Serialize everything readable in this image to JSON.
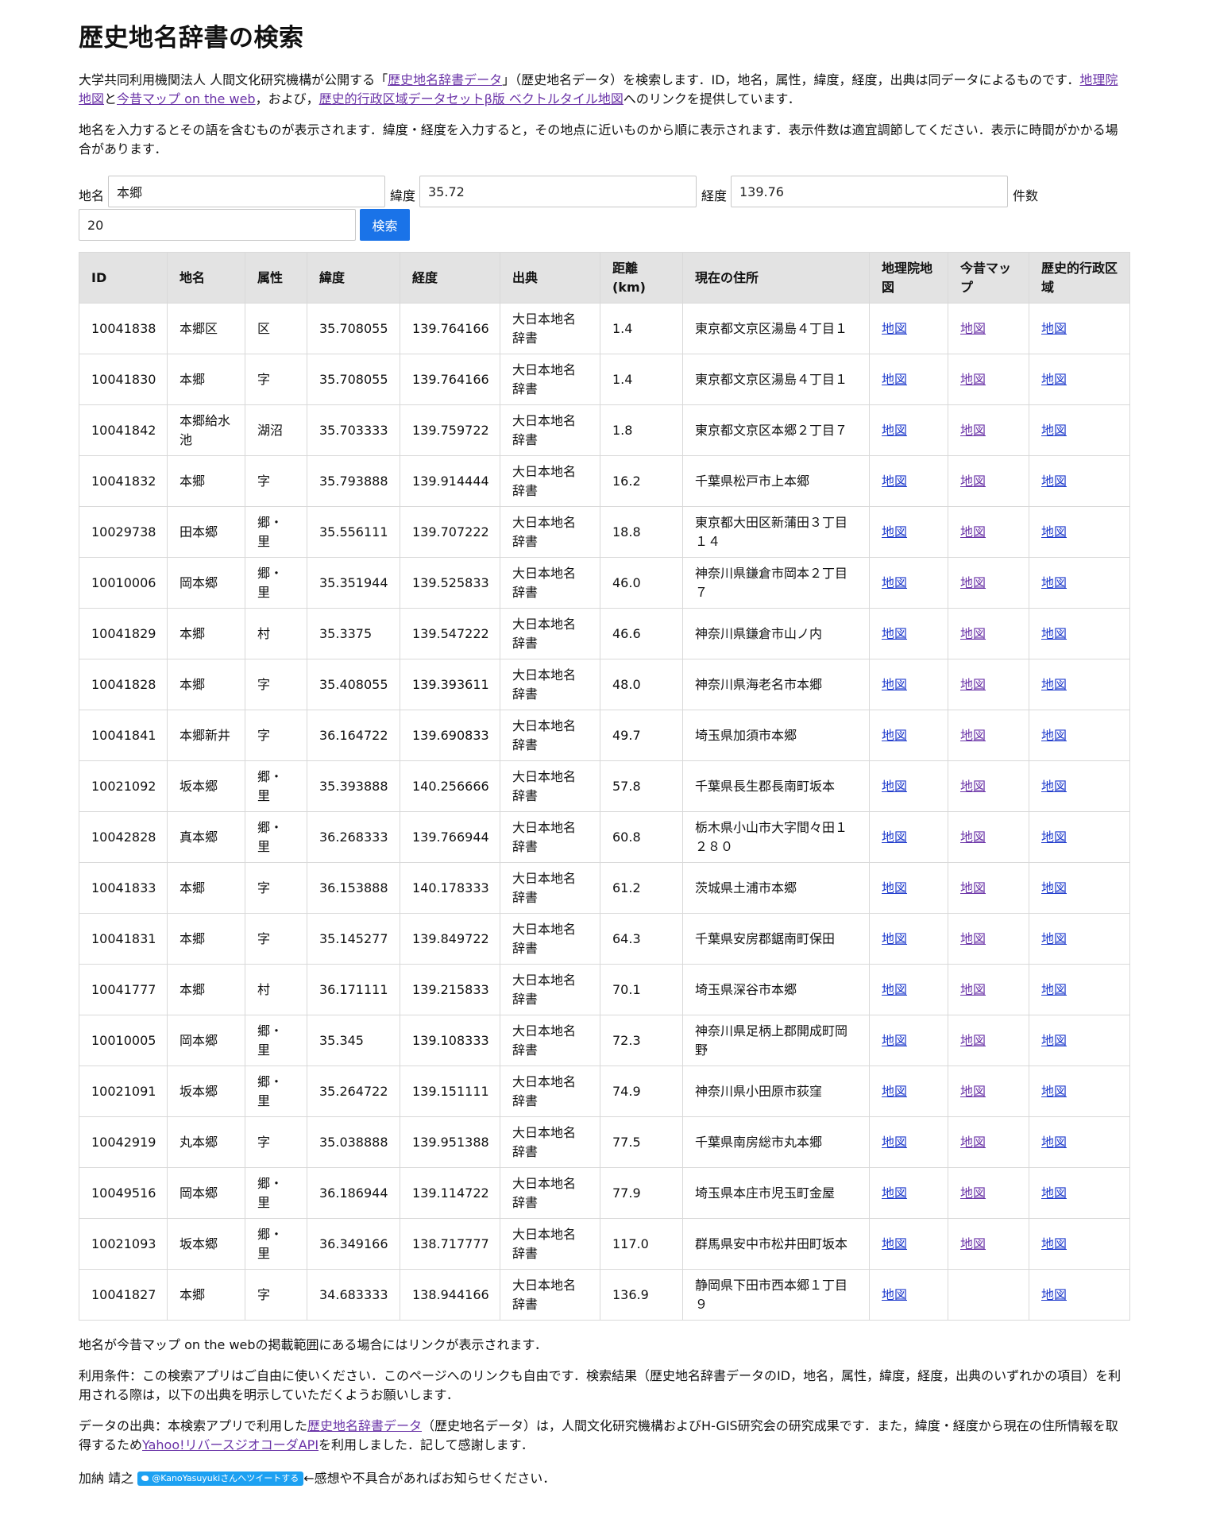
{
  "title": "歴史地名辞書の検索",
  "intro": {
    "part1": "大学共同利用機関法人 人間文化研究機構が公開する「",
    "link1": "歴史地名辞書データ",
    "part2": "」（歴史地名データ）を検索します．ID，地名，属性，緯度，経度，出典は同データによるものです．",
    "link2": "地理院地図",
    "part3": "と",
    "link3": "今昔マップ on the web",
    "part4": "，および，",
    "link4": "歴史的行政区域データセットβ版 ベクトルタイル地図",
    "part5": "へのリンクを提供しています．"
  },
  "instructions": "地名を入力するとその語を含むものが表示されます．緯度・経度を入力すると，その地点に近いものから順に表示されます．表示件数は適宜調節してください．表示に時間がかかる場合があります．",
  "form": {
    "name_label": "地名",
    "name_value": "本郷",
    "lat_label": "緯度",
    "lat_value": "35.72",
    "lon_label": "経度",
    "lon_value": "139.76",
    "count_label": "件数",
    "count_value": "20",
    "search_label": "検索"
  },
  "table": {
    "headers": [
      "ID",
      "地名",
      "属性",
      "緯度",
      "経度",
      "出典",
      "距離(km)",
      "現在の住所",
      "地理院地図",
      "今昔マップ",
      "歴史的行政区域"
    ],
    "link_label": "地図",
    "rows": [
      {
        "id": "10041838",
        "name": "本郷区",
        "attr": "区",
        "lat": "35.708055",
        "lon": "139.764166",
        "src": "大日本地名辞書",
        "dist": "1.4",
        "addr": "東京都文京区湯島４丁目１",
        "konjaku": true
      },
      {
        "id": "10041830",
        "name": "本郷",
        "attr": "字",
        "lat": "35.708055",
        "lon": "139.764166",
        "src": "大日本地名辞書",
        "dist": "1.4",
        "addr": "東京都文京区湯島４丁目１",
        "konjaku": true
      },
      {
        "id": "10041842",
        "name": "本郷給水池",
        "attr": "湖沼",
        "lat": "35.703333",
        "lon": "139.759722",
        "src": "大日本地名辞書",
        "dist": "1.8",
        "addr": "東京都文京区本郷２丁目７",
        "konjaku": true
      },
      {
        "id": "10041832",
        "name": "本郷",
        "attr": "字",
        "lat": "35.793888",
        "lon": "139.914444",
        "src": "大日本地名辞書",
        "dist": "16.2",
        "addr": "千葉県松戸市上本郷",
        "konjaku": true
      },
      {
        "id": "10029738",
        "name": "田本郷",
        "attr": "郷・里",
        "lat": "35.556111",
        "lon": "139.707222",
        "src": "大日本地名辞書",
        "dist": "18.8",
        "addr": "東京都大田区新蒲田３丁目１４",
        "konjaku": true
      },
      {
        "id": "10010006",
        "name": "岡本郷",
        "attr": "郷・里",
        "lat": "35.351944",
        "lon": "139.525833",
        "src": "大日本地名辞書",
        "dist": "46.0",
        "addr": "神奈川県鎌倉市岡本２丁目７",
        "konjaku": true
      },
      {
        "id": "10041829",
        "name": "本郷",
        "attr": "村",
        "lat": "35.3375",
        "lon": "139.547222",
        "src": "大日本地名辞書",
        "dist": "46.6",
        "addr": "神奈川県鎌倉市山ノ内",
        "konjaku": true
      },
      {
        "id": "10041828",
        "name": "本郷",
        "attr": "字",
        "lat": "35.408055",
        "lon": "139.393611",
        "src": "大日本地名辞書",
        "dist": "48.0",
        "addr": "神奈川県海老名市本郷",
        "konjaku": true
      },
      {
        "id": "10041841",
        "name": "本郷新井",
        "attr": "字",
        "lat": "36.164722",
        "lon": "139.690833",
        "src": "大日本地名辞書",
        "dist": "49.7",
        "addr": "埼玉県加須市本郷",
        "konjaku": true
      },
      {
        "id": "10021092",
        "name": "坂本郷",
        "attr": "郷・里",
        "lat": "35.393888",
        "lon": "140.256666",
        "src": "大日本地名辞書",
        "dist": "57.8",
        "addr": "千葉県長生郡長南町坂本",
        "konjaku": true
      },
      {
        "id": "10042828",
        "name": "真本郷",
        "attr": "郷・里",
        "lat": "36.268333",
        "lon": "139.766944",
        "src": "大日本地名辞書",
        "dist": "60.8",
        "addr": "栃木県小山市大字間々田１２８０",
        "konjaku": true
      },
      {
        "id": "10041833",
        "name": "本郷",
        "attr": "字",
        "lat": "36.153888",
        "lon": "140.178333",
        "src": "大日本地名辞書",
        "dist": "61.2",
        "addr": "茨城県土浦市本郷",
        "konjaku": true
      },
      {
        "id": "10041831",
        "name": "本郷",
        "attr": "字",
        "lat": "35.145277",
        "lon": "139.849722",
        "src": "大日本地名辞書",
        "dist": "64.3",
        "addr": "千葉県安房郡鋸南町保田",
        "konjaku": true
      },
      {
        "id": "10041777",
        "name": "本郷",
        "attr": "村",
        "lat": "36.171111",
        "lon": "139.215833",
        "src": "大日本地名辞書",
        "dist": "70.1",
        "addr": "埼玉県深谷市本郷",
        "konjaku": true
      },
      {
        "id": "10010005",
        "name": "岡本郷",
        "attr": "郷・里",
        "lat": "35.345",
        "lon": "139.108333",
        "src": "大日本地名辞書",
        "dist": "72.3",
        "addr": "神奈川県足柄上郡開成町岡野",
        "konjaku": true
      },
      {
        "id": "10021091",
        "name": "坂本郷",
        "attr": "郷・里",
        "lat": "35.264722",
        "lon": "139.151111",
        "src": "大日本地名辞書",
        "dist": "74.9",
        "addr": "神奈川県小田原市荻窪",
        "konjaku": true
      },
      {
        "id": "10042919",
        "name": "丸本郷",
        "attr": "字",
        "lat": "35.038888",
        "lon": "139.951388",
        "src": "大日本地名辞書",
        "dist": "77.5",
        "addr": "千葉県南房総市丸本郷",
        "konjaku": true
      },
      {
        "id": "10049516",
        "name": "岡本郷",
        "attr": "郷・里",
        "lat": "36.186944",
        "lon": "139.114722",
        "src": "大日本地名辞書",
        "dist": "77.9",
        "addr": "埼玉県本庄市児玉町金屋",
        "konjaku": true
      },
      {
        "id": "10021093",
        "name": "坂本郷",
        "attr": "郷・里",
        "lat": "36.349166",
        "lon": "138.717777",
        "src": "大日本地名辞書",
        "dist": "117.0",
        "addr": "群馬県安中市松井田町坂本",
        "konjaku": true
      },
      {
        "id": "10041827",
        "name": "本郷",
        "attr": "字",
        "lat": "34.683333",
        "lon": "138.944166",
        "src": "大日本地名辞書",
        "dist": "136.9",
        "addr": "静岡県下田市西本郷１丁目９",
        "konjaku": false
      }
    ]
  },
  "note": "地名が今昔マップ on the webの掲載範囲にある場合にはリンクが表示されます．",
  "terms": "利用条件：この検索アプリはご自由に使いください．このページへのリンクも自由です．検索結果（歴史地名辞書データのID，地名，属性，緯度，経度，出典のいずれかの項目）を利用される際は，以下の出典を明示していただくようお願いします．",
  "source": {
    "part1": "データの出典：本検索アプリで利用した",
    "link1": "歴史地名辞書データ",
    "part2": "（歴史地名データ）は，人間文化研究機構およびH-GIS研究会の研究成果です．また，緯度・経度から現在の住所情報を取得するため",
    "link2": "Yahoo!リバースジオコーダAPI",
    "part3": "を利用しました．記して感謝します．"
  },
  "footer": {
    "author": "加納 靖之",
    "tweet_label": "@KanoYasuyukiさんへツイートする",
    "message": "←感想や不具合があればお知らせください．"
  },
  "colors": {
    "link": "#1f3bcc",
    "visited_link": "#6a33a7",
    "button": "#1a73e8",
    "tweet": "#1da1f2",
    "header_bg": "#e3e3e3"
  }
}
